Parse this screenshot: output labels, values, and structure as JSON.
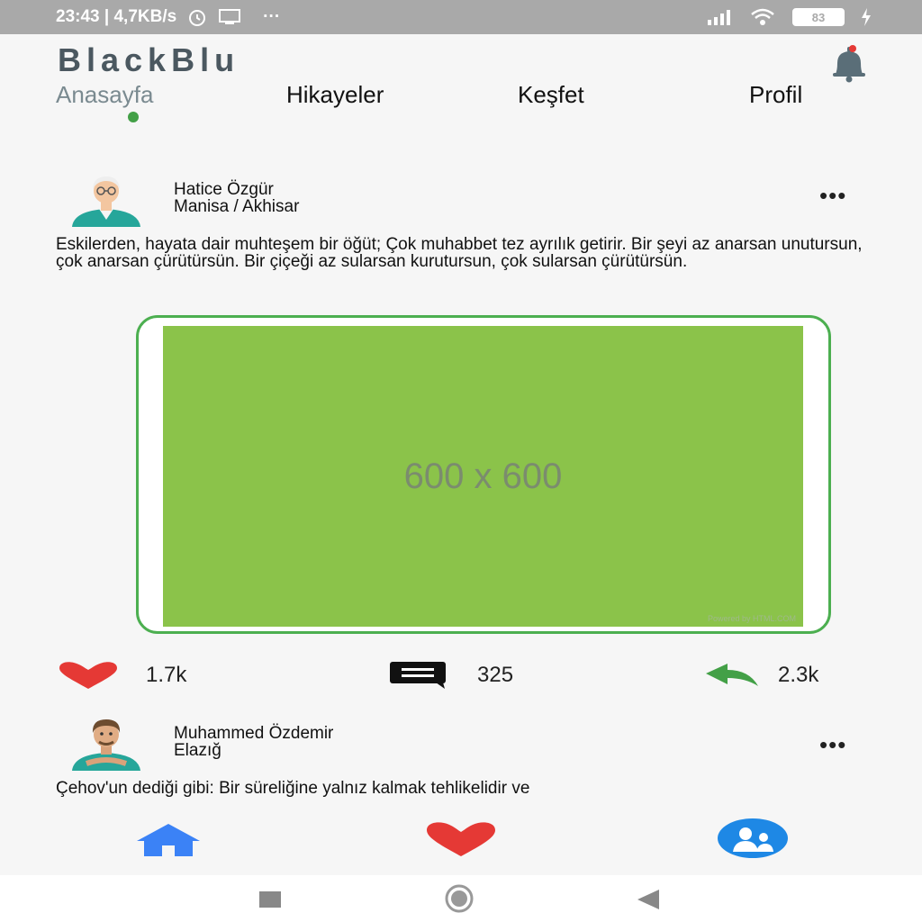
{
  "status_bar": {
    "left_text": "23:43 | 4,7KB/s",
    "battery": "83"
  },
  "app": {
    "brand": "BlackBlu",
    "tabs": [
      {
        "label": "Anasayfa",
        "active": true
      },
      {
        "label": "Hikayeler",
        "active": false
      },
      {
        "label": "Keşfet",
        "active": false
      },
      {
        "label": "Profil",
        "active": false
      }
    ]
  },
  "posts": [
    {
      "author_name": "Hatice Özgür",
      "author_location": "Manisa / Akhisar",
      "more": "•••",
      "text": "Eskilerden, hayata dair muhteşem bir öğüt; Çok muhabbet tez ayrılık getirir. Bir şeyi az anarsan unutursun, çok anarsan çürütürsün. Bir çiçeği az sularsan kurutursun, çok sularsan çürütürsün.",
      "image_placeholder": "600 x 600",
      "image_credit": "Powered by HTML.COM",
      "likes": "1.7k",
      "comments": "325",
      "shares": "2.3k"
    },
    {
      "author_name": "Muhammed Özdemir",
      "author_location": "Elazığ",
      "more": "•••",
      "text": "Çehov'un dediği gibi: Bir süreliğine yalnız kalmak tehlikelidir ve"
    }
  ],
  "colors": {
    "accent_green": "#4caf50",
    "image_green": "#8bc34a",
    "like_red": "#e53935",
    "share_green": "#43a047",
    "home_blue": "#3b82f6",
    "friends_blue": "#1e88e5"
  },
  "icons": {
    "notification": "bell-icon",
    "like": "heart-icon",
    "comment": "comment-icon",
    "share": "reply-icon",
    "nav_home": "home-icon",
    "nav_favorites": "heart-icon",
    "nav_friends": "friends-icon"
  }
}
